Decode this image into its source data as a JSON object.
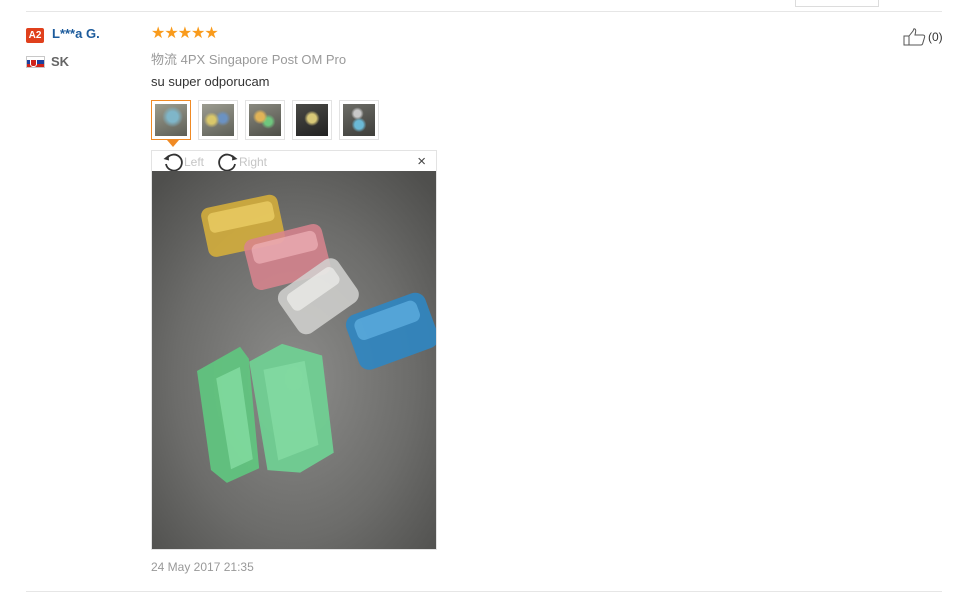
{
  "review": {
    "reviewer": {
      "level_badge": "A2",
      "name": "L***a G.",
      "country_code": "SK",
      "flag_icon": "slovakia-flag-icon"
    },
    "rating": {
      "stars": 5,
      "stars_text": "★★★★★",
      "star_color": "#f99b1c"
    },
    "shipping": {
      "label": "物流",
      "method": "4PX Singapore Post OM Pro"
    },
    "text": "su super odporucam",
    "helpful": {
      "count_text": "(0)",
      "icon": "thumbs-up-icon"
    },
    "thumbnails": [
      {
        "name": "review-photo-thumbnail-1",
        "active": true
      },
      {
        "name": "review-photo-thumbnail-2",
        "active": false
      },
      {
        "name": "review-photo-thumbnail-3",
        "active": false
      },
      {
        "name": "review-photo-thumbnail-4",
        "active": false
      },
      {
        "name": "review-photo-thumbnail-5",
        "active": false
      }
    ],
    "viewer": {
      "rotate_left_label": "Left",
      "rotate_right_label": "Right",
      "close_symbol": "×"
    },
    "date": "24 May 2017 21:35"
  },
  "colors": {
    "accent_orange": "#f08a24",
    "badge_red": "#e0401c",
    "name_blue": "#1c5b9c"
  }
}
